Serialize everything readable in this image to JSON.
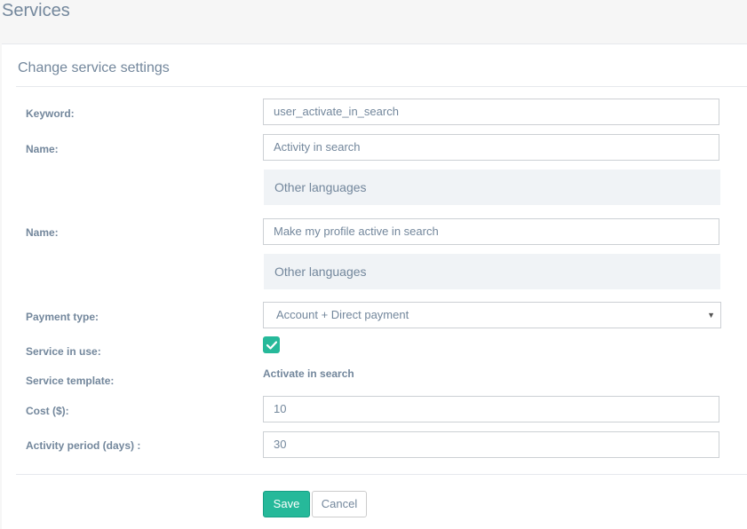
{
  "page": {
    "title": "Services"
  },
  "panel": {
    "title": "Change service settings"
  },
  "form": {
    "keyword": {
      "label": "Keyword:",
      "value": "user_activate_in_search"
    },
    "name1": {
      "label": "Name:",
      "value": "Activity in search"
    },
    "other_languages_1": "Other languages",
    "name2": {
      "label": "Name:",
      "value": "Make my profile active in search"
    },
    "other_languages_2": "Other languages",
    "payment_type": {
      "label": "Payment type:",
      "value": "Account + Direct payment"
    },
    "service_in_use": {
      "label": "Service in use:",
      "checked": true
    },
    "service_template": {
      "label": "Service template:",
      "value": "Activate in search"
    },
    "cost": {
      "label": "Cost ($):",
      "value": "10"
    },
    "activity_period": {
      "label": "Activity period (days) :",
      "value": "30"
    }
  },
  "buttons": {
    "save": "Save",
    "cancel": "Cancel"
  },
  "colors": {
    "accent": "#26b99a",
    "text": "#73879c"
  }
}
